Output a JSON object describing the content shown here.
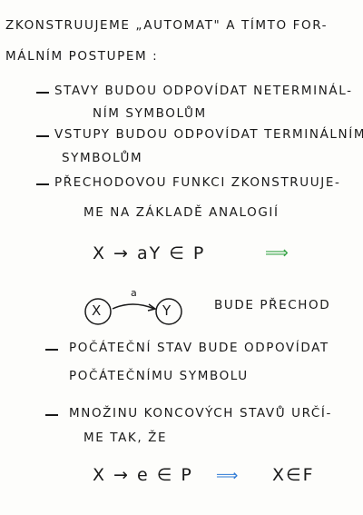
{
  "intro": {
    "line1": "ZKONSTRUUJEME „AUTOMAT\" A TÍMTO FOR-",
    "line2": "MÁLNÍM POSTUPEM :"
  },
  "bullets": [
    {
      "line1": "STAVY BUDOU ODPOVÍDAT NETERMINÁL-",
      "line2": "NÍM SYMBOLŮM"
    },
    {
      "line1": "VSTUPY BUDOU ODPOVÍDAT TERMINÁLNÍM",
      "line2": "SYMBOLŮM"
    },
    {
      "line1": "PŘECHODOVOU FUNKCI ZKONSTRUUJE-",
      "line2": "ME NA ZÁKLADĚ ANALOGIÍ"
    }
  ],
  "rule1": {
    "text": "X → aY  ∈ P",
    "arrow": "⟹"
  },
  "diagram": {
    "state_from": "X",
    "state_to": "Y",
    "edge_label": "a",
    "caption": "BUDE PŘECHOD"
  },
  "bullets2": [
    {
      "line1": "POČÁTEČNÍ STAV BUDE ODPOVÍDAT",
      "line2": "POČÁTEČNÍMU SYMBOLU"
    },
    {
      "line1": "MNOŽINU KONCOVÝCH STAVŮ URČÍ-",
      "line2": "ME TAK, ŽE"
    }
  ],
  "rule2": {
    "left": "X → e ∈ P",
    "arrow": "⟹",
    "right": "X∈F"
  },
  "colors": {
    "ink": "#1a1a1a",
    "green_arrow": "#3aa54a",
    "blue_arrow": "#2f7bd6"
  }
}
